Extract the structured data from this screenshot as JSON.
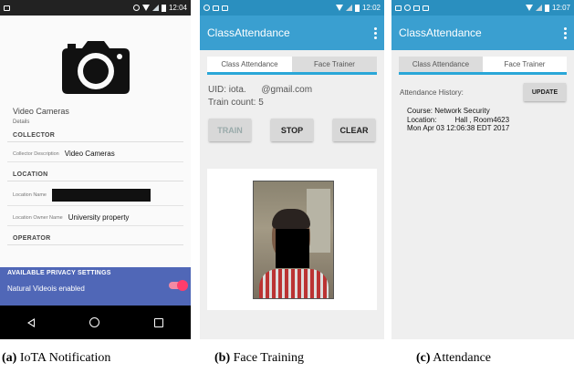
{
  "phone_a": {
    "status_time": "12:04",
    "camera_title": "Video Cameras",
    "details_label": "Details",
    "collector_section": "COLLECTOR",
    "collector_desc_label": "Collector Description",
    "collector_desc_value": "Video Cameras",
    "location_section": "LOCATION",
    "location_name_label": "Location Name",
    "location_owner_label": "Location Owner Name",
    "location_owner_value": "University property",
    "operator_section": "OPERATOR",
    "privacy_header": "AVAILABLE PRIVACY SETTINGS",
    "privacy_option": "Natural Videois enabled",
    "privacy_toggle_on": true
  },
  "phone_b": {
    "status_time": "12:02",
    "app_title": "ClassAttendance",
    "tabs": [
      "Class Attendance",
      "Face Trainer"
    ],
    "active_tab": 1,
    "uid_line": "UID: iota.      @gmail.com",
    "train_count_line": "Train count: 5",
    "buttons": {
      "train": "TRAIN",
      "stop": "STOP",
      "clear": "CLEAR"
    }
  },
  "phone_c": {
    "status_time": "12:07",
    "app_title": "ClassAttendance",
    "tabs": [
      "Class Attendance",
      "Face Trainer"
    ],
    "active_tab": 0,
    "history_label": "Attendance History:",
    "update_button": "UPDATE",
    "record": {
      "course": "Course: Network Security",
      "location": "Location:         Hall , Room4623",
      "timestamp": "Mon Apr 03 12:06:38 EDT 2017"
    }
  },
  "captions": [
    {
      "letter": "(a)",
      "text": " IoTA Notification"
    },
    {
      "letter": "(b)",
      "text": " Face Training"
    },
    {
      "letter": "(c)",
      "text": " Attendance"
    }
  ],
  "colors": {
    "app_bar": "#3a9fd0",
    "status_bar": "#2a8fbf",
    "tab_indicator": "#2aa7d8",
    "privacy_panel": "#5067b7",
    "toggle_accent": "#ff3d6b"
  },
  "icons": [
    "camera-icon",
    "back-nav-icon",
    "home-nav-icon",
    "recent-apps-icon",
    "overflow-menu-icon",
    "battery-icon",
    "wifi-icon"
  ]
}
